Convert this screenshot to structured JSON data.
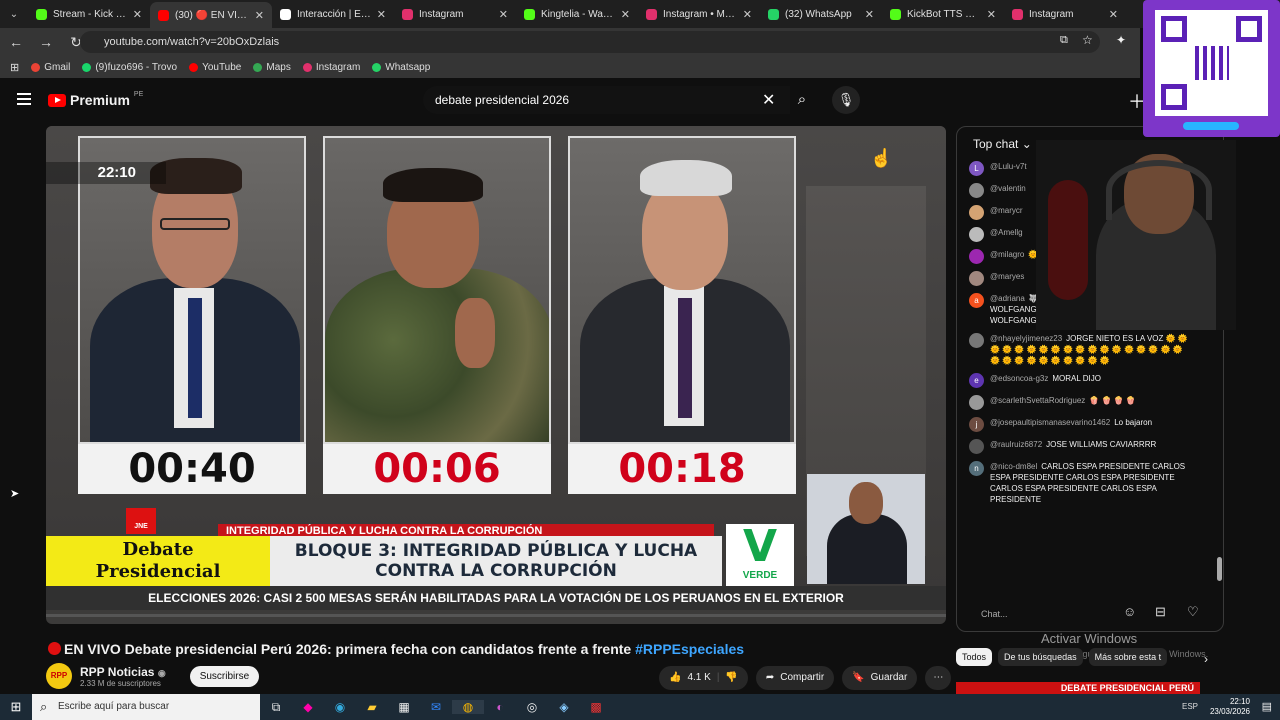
{
  "browser": {
    "tabs": [
      {
        "label": "Stream - Kick Da",
        "color": "#53fc18"
      },
      {
        "label": "(30) 🔴 EN VIVO D",
        "color": "#ff0000",
        "active": true
      },
      {
        "label": "Interacción | El mejo",
        "color": "#ffffff"
      },
      {
        "label": "Instagram",
        "color": "#e1306c"
      },
      {
        "label": "Kingtelia - Watch clip",
        "color": "#53fc18"
      },
      {
        "label": "Instagram • Mensajes",
        "color": "#e1306c"
      },
      {
        "label": "(32) WhatsApp",
        "color": "#25d366"
      },
      {
        "label": "KickBot TTS Settings",
        "color": "#53fc18"
      },
      {
        "label": "Instagram",
        "color": "#e1306c"
      }
    ],
    "url": "youtube.com/watch?v=20bOxDzlais",
    "bookmarks": [
      {
        "label": "Gmail",
        "color": "#ea4335"
      },
      {
        "label": "(9)fuzo696 - Trovo",
        "color": "#19d66b"
      },
      {
        "label": "YouTube",
        "color": "#ff0000"
      },
      {
        "label": "Maps",
        "color": "#34a853"
      },
      {
        "label": "Instagram",
        "color": "#e1306c"
      },
      {
        "label": "Whatsapp",
        "color": "#25d366"
      }
    ]
  },
  "youtube": {
    "logo": "Premium",
    "logo_suffix": "PE",
    "search_value": "debate presidencial 2026"
  },
  "video": {
    "clock": "22:10",
    "timers": [
      "00:40",
      "00:06",
      "00:18"
    ],
    "red_banner": "INTEGRIDAD PÚBLICA Y LUCHA CONTRA LA CORRUPCIÓN",
    "debate_line1": "Debate",
    "debate_line2": "Presidencial",
    "bloque_line1": "BLOQUE 3: INTEGRIDAD PÚBLICA Y LUCHA",
    "bloque_line2": "CONTRA LA CORRUPCIÓN",
    "party_letter": "V",
    "party_name": "VERDE",
    "jne": "JNE",
    "ticker": "ELECCIONES 2026: CASI 2 500 MESAS SERÁN HABILITADAS PARA LA VOTACIÓN DE LOS PERUANOS EN EL EXTERIOR"
  },
  "chat": {
    "header": "Top chat",
    "messages": [
      {
        "author": "@Lulu-v7t",
        "text": "",
        "avatar": "L",
        "color": "#7e57c2"
      },
      {
        "author": "@valentin",
        "text": "",
        "avatar": "",
        "color": "#888888"
      },
      {
        "author": "@marycr",
        "text": "",
        "avatar": "",
        "color": "#d4a373"
      },
      {
        "author": "@Amellg",
        "text": "",
        "avatar": "",
        "color": "#bbbbbb"
      },
      {
        "author": "@milagro",
        "text": "🌞 🌞",
        "avatar": "",
        "color": "#9c27b0"
      },
      {
        "author": "@maryes",
        "text": "",
        "avatar": "",
        "color": "#a1887f"
      },
      {
        "author": "@adriana",
        "text": "🐺 🐺 WOLFGANG 🐺 🐺 🐺 🐺 WOLFGANG 🐺 🐺 🐺 🐺 WOLFGANG 🐺 🐺 🐺 🐺 WOLFGANG 🐺 🐺 🐺 🐺",
        "avatar": "a",
        "color": "#f4511e"
      },
      {
        "author": "@nhayelyjimenez23",
        "text": "JORGE NIETO ES LA VOZ 🌞 🌞 🌞 🌞 🌞 🌞 🌞 🌞 🌞 🌞 🌞 🌞 🌞 🌞 🌞 🌞 🌞 🌞 🌞 🌞 🌞 🌞 🌞 🌞 🌞 🌞 🌞 🌞",
        "avatar": "",
        "color": "#777777"
      },
      {
        "author": "@edsoncoa-g3z",
        "text": "MORAL DIJO",
        "avatar": "e",
        "color": "#5e35b1"
      },
      {
        "author": "@scarlethSvettaRodriguez",
        "text": "🍿 🍿 🍿 🍿",
        "avatar": "",
        "color": "#999999"
      },
      {
        "author": "@josepaultipismanasevarino1462",
        "text": "Lo bajaron",
        "avatar": "j",
        "color": "#6d4c41"
      },
      {
        "author": "@raulruiz6872",
        "text": "JOSE WILLIAMS CAVIARRRR",
        "avatar": "",
        "color": "#555555"
      },
      {
        "author": "@nico-dm8el",
        "text": "CARLOS ESPA PRESIDENTE CARLOS ESPA PRESIDENTE CARLOS ESPA PRESIDENTE CARLOS ESPA PRESIDENTE CARLOS ESPA PRESIDENTE",
        "avatar": "n",
        "color": "#546e7a"
      }
    ],
    "input_placeholder": "Chat..."
  },
  "watch": {
    "title": "EN VIVO Debate presidencial Perú 2026: primera fecha con candidatos frente a frente",
    "hashtag": "#RPPEspeciales",
    "channel": "RPP Noticias",
    "channel_avatar": "RPP",
    "subscribers": "2.33 M de suscriptores",
    "subscribe": "Suscribirse",
    "likes": "4.1 K",
    "share": "Compartir",
    "save": "Guardar"
  },
  "sidebar": {
    "windows_activate": "Activar Windows",
    "windows_activate_sub": "Ve a Configuración para activar Windows.",
    "chips": [
      "Todos",
      "De tus búsquedas",
      "Más sobre esta t"
    ],
    "rec_title": "DEBATE PRESIDENCIAL PERÚ"
  },
  "taskbar": {
    "search_placeholder": "Escribe aquí para buscar",
    "lang": "ESP",
    "time": "22:10",
    "date": "23/03/2026"
  }
}
